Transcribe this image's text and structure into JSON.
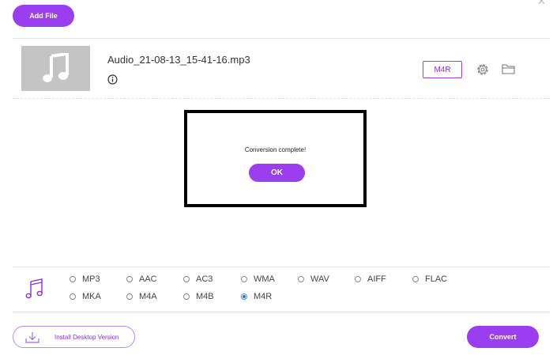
{
  "toolbar": {
    "add_file_label": "Add File"
  },
  "file": {
    "name": "Audio_21-08-13_15-41-16.mp3",
    "selected_format": "M4R"
  },
  "dialog": {
    "message": "Conversion complete!",
    "ok_label": "OK"
  },
  "formats": {
    "row1": [
      "MP3",
      "AAC",
      "AC3",
      "WMA",
      "WAV",
      "AIFF",
      "FLAC"
    ],
    "row2": [
      "MKA",
      "M4A",
      "M4B",
      "M4R"
    ],
    "selected": "M4R"
  },
  "footer": {
    "install_label": "Install Desktop Version",
    "convert_label": "Convert"
  },
  "colors": {
    "accent": "#9b3ef0",
    "radio_selected": "#2a6fd6"
  },
  "icons": [
    "music-note-icon",
    "info-icon",
    "gear-icon",
    "folder-icon",
    "download-icon",
    "close-icon"
  ]
}
